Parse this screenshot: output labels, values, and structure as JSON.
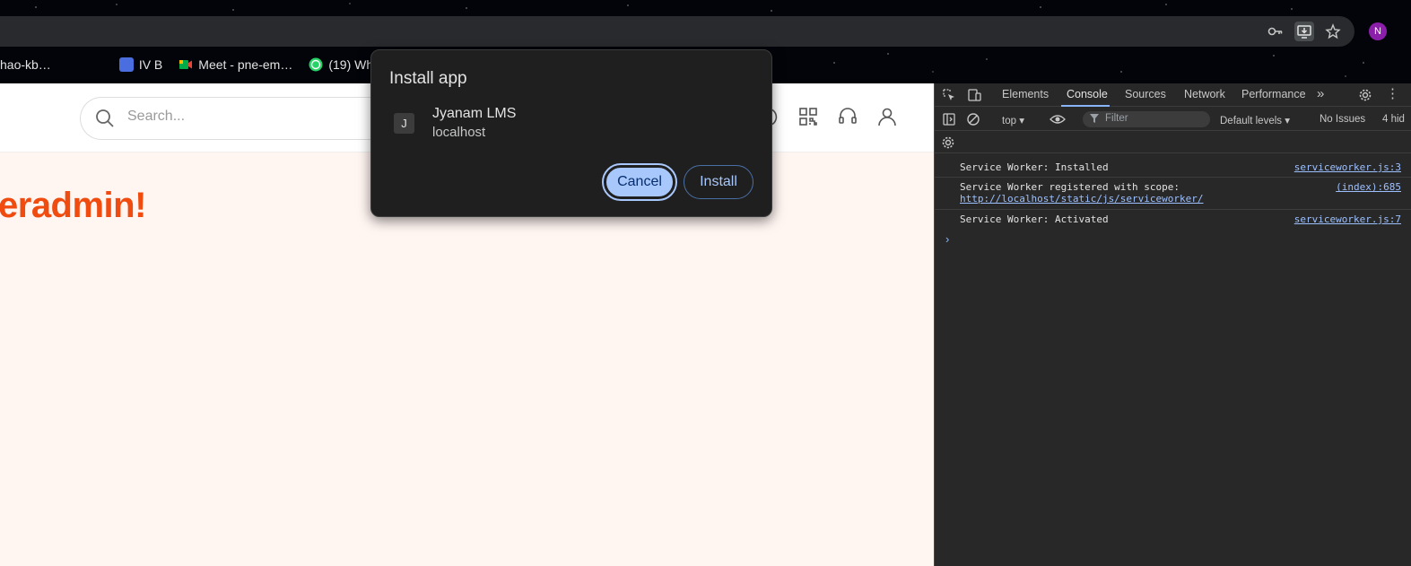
{
  "bookmarks": [
    {
      "label": "hao-kb…",
      "icon": "bookmark-icon",
      "color": ""
    },
    {
      "label": "IV B",
      "icon": "contacts-icon",
      "color": "#4a6ee0"
    },
    {
      "label": "Meet - pne-em…",
      "icon": "meet-icon",
      "color": "#00ac47"
    },
    {
      "label": "(19) WhatsApp",
      "icon": "whatsapp-icon",
      "color": "#25d366"
    }
  ],
  "toolbar": {
    "icons": [
      "password-key-icon",
      "install-app-icon",
      "bookmark-star-icon"
    ],
    "avatar_initial": "N",
    "avatar_color": "#8b1fa9"
  },
  "page": {
    "search_placeholder": "Search...",
    "greeting": "eradmin!",
    "accent": "#f04c10"
  },
  "dialog": {
    "title": "Install app",
    "app_icon_letter": "J",
    "app_name": "Jyanam LMS",
    "app_host": "localhost",
    "cancel_label": "Cancel",
    "install_label": "Install"
  },
  "devtools": {
    "tabs": [
      "Elements",
      "Console",
      "Sources",
      "Network",
      "Performance"
    ],
    "active_tab": "Console",
    "context": "top",
    "filter_placeholder": "Filter",
    "levels": "Default levels",
    "issues": "No Issues",
    "hidden": "4 hid",
    "logs": [
      {
        "message": "Service Worker: Installed",
        "source": "serviceworker.js:3"
      },
      {
        "message": "Service Worker registered with scope:",
        "link": "http://localhost/static/js/serviceworker/",
        "source": "(index):685"
      },
      {
        "message": "Service Worker: Activated",
        "source": "serviceworker.js:7"
      }
    ]
  }
}
